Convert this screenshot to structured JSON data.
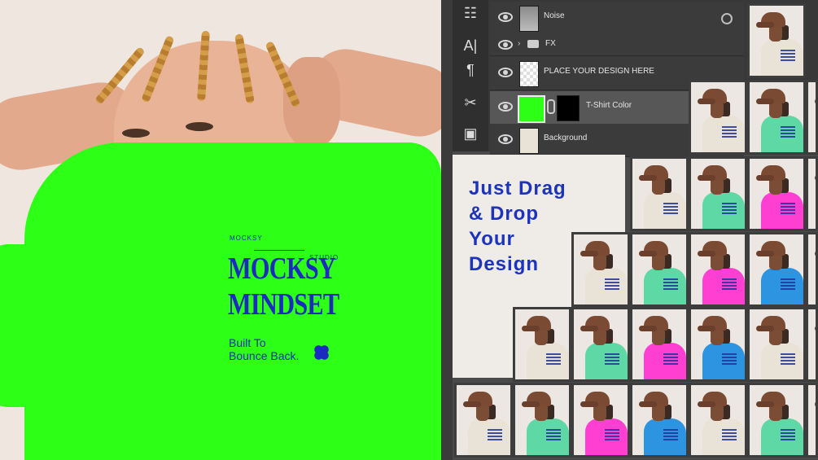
{
  "print": {
    "top_left": "MOCKSY",
    "top_right": "STUDIO",
    "title_line1": "MOCKSY",
    "title_line2": "MINDSET",
    "tagline_line1": "Built To",
    "tagline_line2": "Bounce Back."
  },
  "layers": [
    {
      "name": "Noise"
    },
    {
      "name": "FX"
    },
    {
      "name": "PLACE YOUR DESIGN HERE"
    },
    {
      "name": "T-Shirt Color"
    },
    {
      "name": "Background"
    }
  ],
  "headline": {
    "line1": "Just Drag",
    "line2": "& Drop",
    "line3": "Your",
    "line4": "Design"
  },
  "colors": {
    "shirt_green": "#2dff16",
    "print_blue": "#1b2bbf",
    "variant_colors": [
      "#e9e2d6",
      "#5ed9a6",
      "#ff3fd2",
      "#2c94e0"
    ]
  }
}
